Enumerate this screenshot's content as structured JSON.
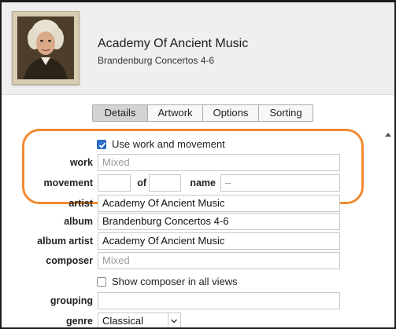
{
  "header": {
    "album_artist": "Academy Of Ancient Music",
    "album_title": "Brandenburg Concertos 4-6"
  },
  "tabs": [
    {
      "label": "Details",
      "active": true
    },
    {
      "label": "Artwork",
      "active": false
    },
    {
      "label": "Options",
      "active": false
    },
    {
      "label": "Sorting",
      "active": false
    }
  ],
  "work_section": {
    "use_work_label": "Use work and movement",
    "use_work_checked": true,
    "work_label": "work",
    "work_placeholder": "Mixed",
    "movement_label": "movement",
    "movement_value": "",
    "of_label": "of",
    "movement_count": "",
    "name_label": "name",
    "name_value": "–"
  },
  "fields": {
    "artist_label": "artist",
    "artist_value": "Academy Of Ancient Music",
    "album_label": "album",
    "album_value": "Brandenburg Concertos 4-6",
    "album_artist_label": "album artist",
    "album_artist_value": "Academy Of Ancient Music",
    "composer_label": "composer",
    "composer_placeholder": "Mixed",
    "show_composer_label": "Show composer in all views",
    "show_composer_checked": false,
    "grouping_label": "grouping",
    "grouping_value": "",
    "genre_label": "genre",
    "genre_value": "Classical"
  },
  "colors": {
    "highlight": "#f28a30",
    "active_tab": "#d3d3d3",
    "checkbox_checked": "#2e6fd0"
  }
}
